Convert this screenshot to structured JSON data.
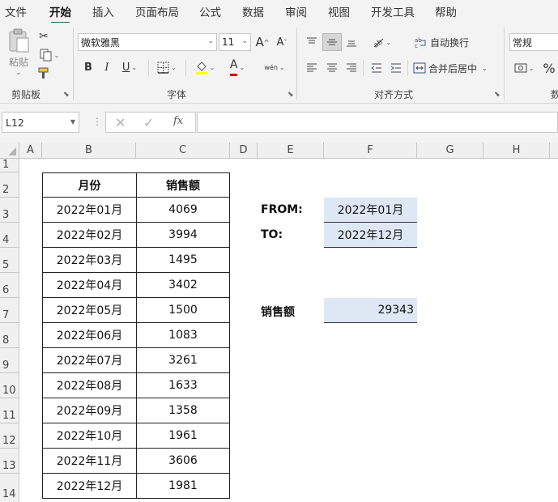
{
  "menu": {
    "tabs": [
      "文件",
      "开始",
      "插入",
      "页面布局",
      "公式",
      "数据",
      "审阅",
      "视图",
      "开发工具",
      "帮助"
    ],
    "active": "开始"
  },
  "ribbon": {
    "clipboard": {
      "paste_label": "粘贴",
      "group_label": "剪贴板"
    },
    "font": {
      "font_name": "微软雅黑",
      "font_size": "11",
      "bold": "B",
      "italic": "I",
      "underline": "U",
      "grow": "A",
      "shrink": "A",
      "font_color_glyph": "A",
      "phonetic_glyph": "wén",
      "group_label": "字体"
    },
    "alignment": {
      "wrap_label": "自动换行",
      "merge_label": "合并后居中",
      "group_label": "对齐方式"
    },
    "number": {
      "format": "常规",
      "percent": "%",
      "group_label_partial": "数"
    }
  },
  "formula_bar": {
    "name_box": "L12",
    "cancel": "✕",
    "enter": "✓",
    "fx": "fx",
    "formula": ""
  },
  "columns": [
    "A",
    "B",
    "C",
    "D",
    "E",
    "F",
    "G",
    "H"
  ],
  "rows": [
    "1",
    "2",
    "3",
    "4",
    "5",
    "6",
    "7",
    "8",
    "9",
    "10",
    "11",
    "12",
    "13",
    "14"
  ],
  "table": {
    "header": [
      "月份",
      "销售额"
    ],
    "rows": [
      [
        "2022年01月",
        "4069"
      ],
      [
        "2022年02月",
        "3994"
      ],
      [
        "2022年03月",
        "1495"
      ],
      [
        "2022年04月",
        "3402"
      ],
      [
        "2022年05月",
        "1500"
      ],
      [
        "2022年06月",
        "1083"
      ],
      [
        "2022年07月",
        "3261"
      ],
      [
        "2022年08月",
        "1633"
      ],
      [
        "2022年09月",
        "1358"
      ],
      [
        "2022年10月",
        "1961"
      ],
      [
        "2022年11月",
        "3606"
      ],
      [
        "2022年12月",
        "1981"
      ]
    ]
  },
  "criteria": {
    "from_label": "FROM:",
    "from_value": "2022年01月",
    "to_label": "TO:",
    "to_value": "2022年12月",
    "result_label": "销售额",
    "result_value": "29343"
  }
}
